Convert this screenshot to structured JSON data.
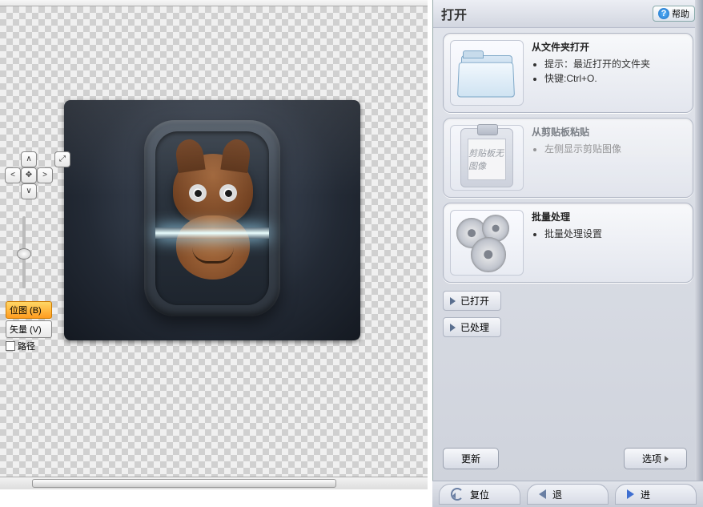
{
  "canvas": {
    "tabs": {
      "bitmap": "位图 (B)",
      "vector": "矢量 (V)",
      "path_label": "路径"
    },
    "nav": {
      "up": "∧",
      "down": "∨",
      "left": "<",
      "center": "✥",
      "right": ">",
      "expand": "⤢"
    }
  },
  "panel": {
    "title": "打开",
    "help": "帮助",
    "cards": {
      "folder": {
        "title": "从文件夹打开",
        "line1": "提示：最近打开的文件夹",
        "line2": "快键:Ctrl+O."
      },
      "clipboard": {
        "title": "从剪贴板粘贴",
        "line1": "左侧显示剪贴图像",
        "empty": "剪贴板无图像"
      },
      "batch": {
        "title": "批量处理",
        "line1": "批量处理设置"
      }
    },
    "opened_btn": "已打开",
    "processed_btn": "已处理",
    "update_btn": "更新",
    "options_btn": "选项"
  },
  "footer": {
    "reset": "复位",
    "back": "退",
    "forward": "进"
  }
}
